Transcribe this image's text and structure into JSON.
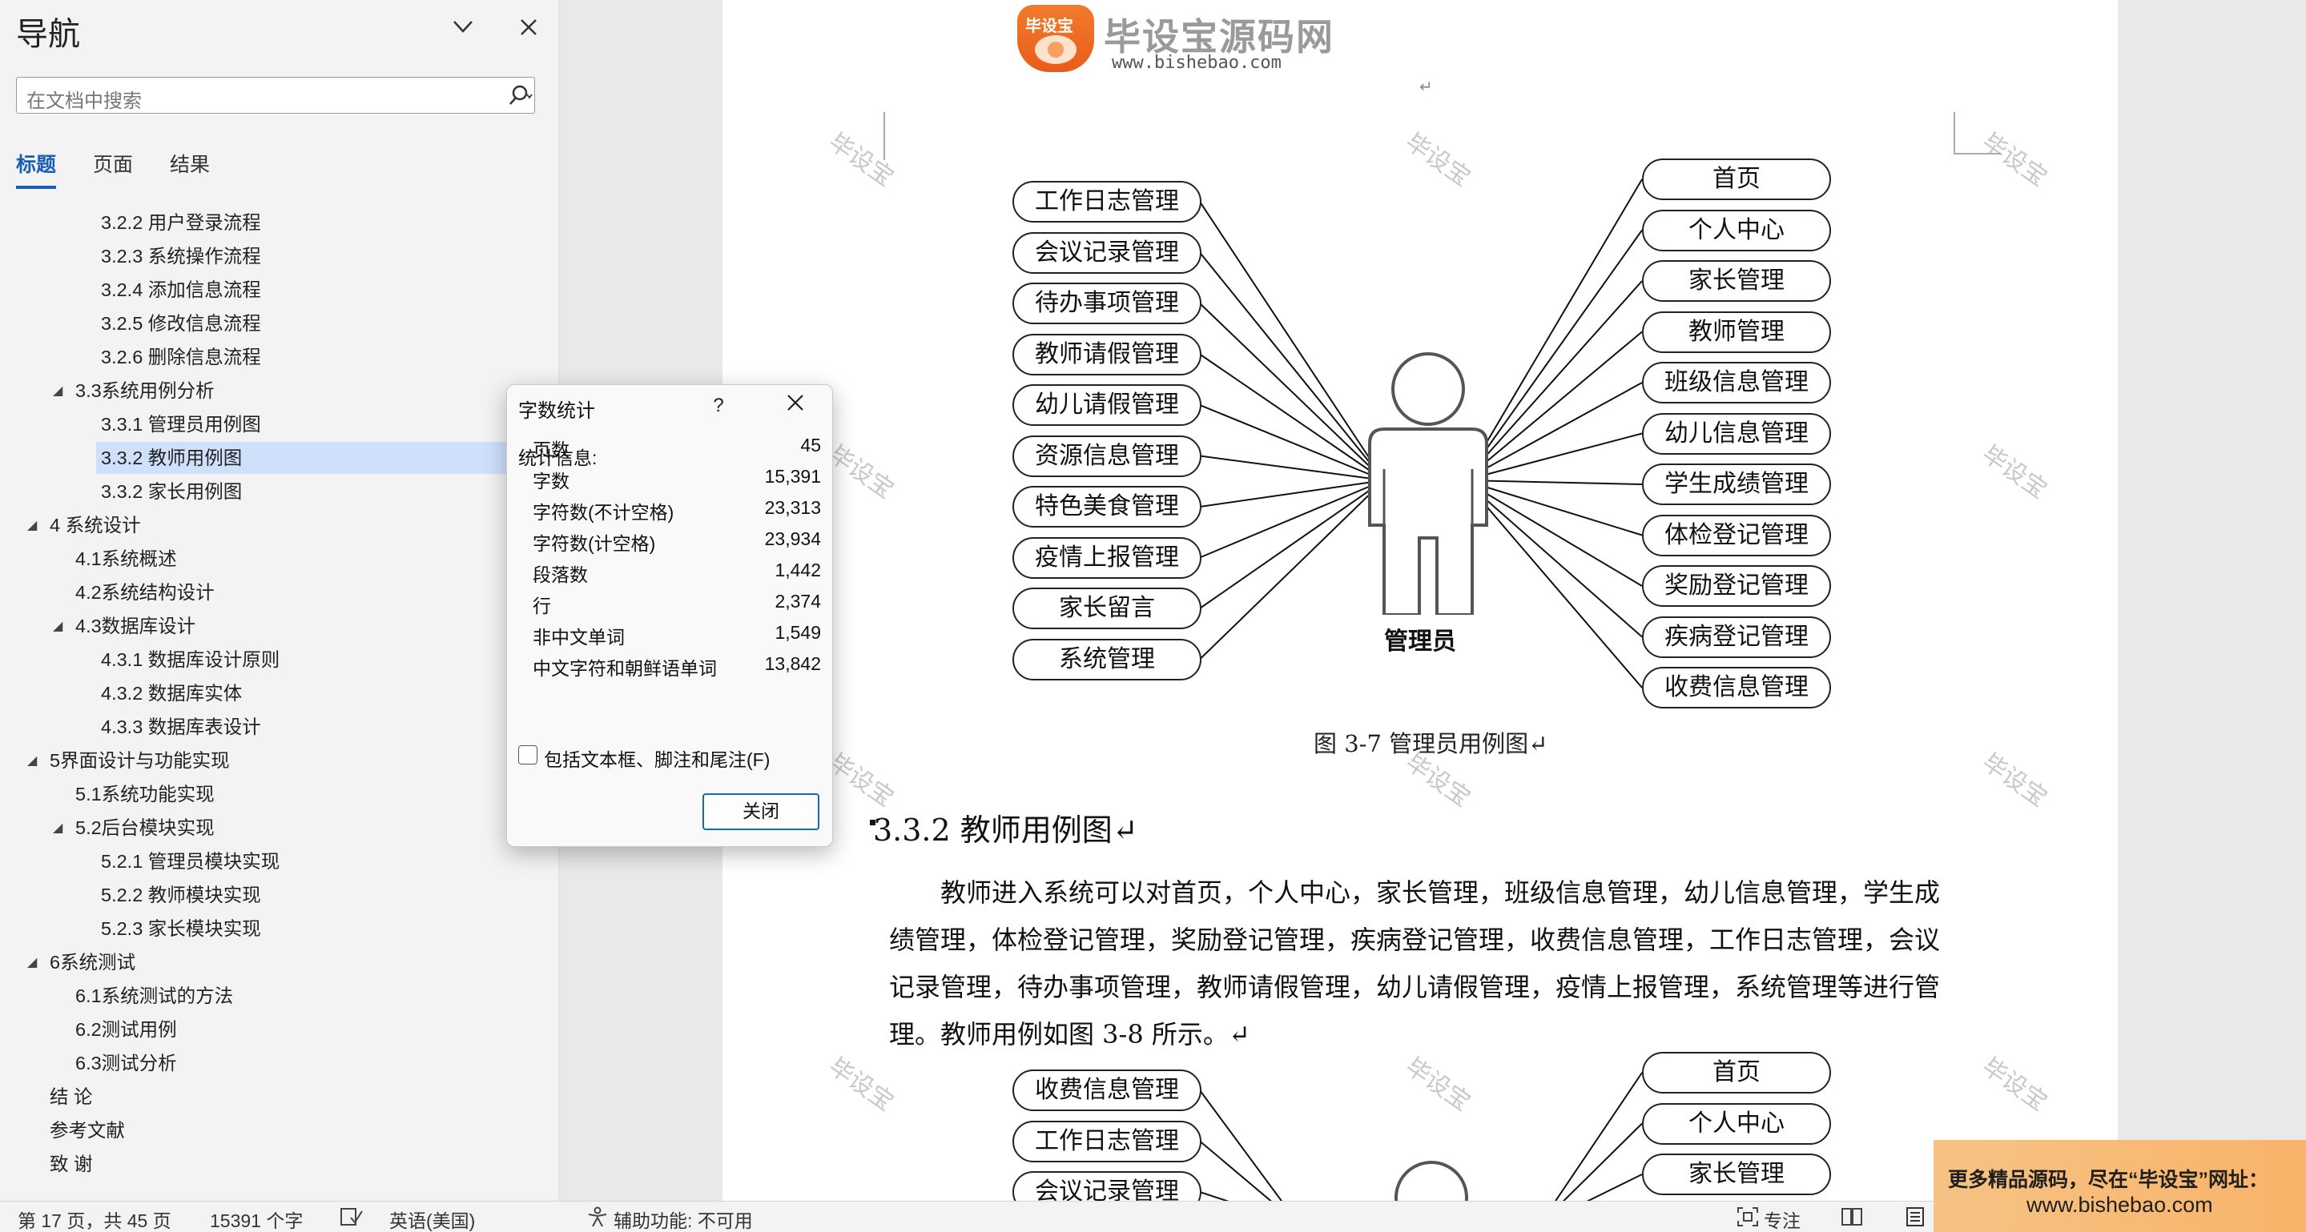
{
  "nav": {
    "title": "导航",
    "search_placeholder": "在文档中搜索",
    "tabs": [
      "标题",
      "页面",
      "结果"
    ],
    "outline": [
      {
        "text": "3.2.2 用户登录流程",
        "level": 3
      },
      {
        "text": "3.2.3 系统操作流程",
        "level": 3
      },
      {
        "text": "3.2.4 添加信息流程",
        "level": 3
      },
      {
        "text": "3.2.5 修改信息流程",
        "level": 3
      },
      {
        "text": "3.2.6 删除信息流程",
        "level": 3
      },
      {
        "text": "3.3系统用例分析",
        "level": 2,
        "expanded": true
      },
      {
        "text": "3.3.1 管理员用例图",
        "level": 3
      },
      {
        "text": "3.3.2 教师用例图",
        "level": 3,
        "selected": true
      },
      {
        "text": "3.3.2 家长用例图",
        "level": 3
      },
      {
        "text": "4 系统设计",
        "level": 1,
        "expanded": true
      },
      {
        "text": "4.1系统概述",
        "level": 2
      },
      {
        "text": "4.2系统结构设计",
        "level": 2
      },
      {
        "text": "4.3数据库设计",
        "level": 2,
        "expanded": true
      },
      {
        "text": "4.3.1 数据库设计原则",
        "level": 3
      },
      {
        "text": "4.3.2 数据库实体",
        "level": 3
      },
      {
        "text": "4.3.3 数据库表设计",
        "level": 3
      },
      {
        "text": "5界面设计与功能实现",
        "level": 1,
        "expanded": true
      },
      {
        "text": "5.1系统功能实现",
        "level": 2
      },
      {
        "text": "5.2后台模块实现",
        "level": 2,
        "expanded": true
      },
      {
        "text": "5.2.1 管理员模块实现",
        "level": 3
      },
      {
        "text": "5.2.2 教师模块实现",
        "level": 3
      },
      {
        "text": "5.2.3 家长模块实现",
        "level": 3
      },
      {
        "text": "6系统测试",
        "level": 1,
        "expanded": true
      },
      {
        "text": "6.1系统测试的方法",
        "level": 2
      },
      {
        "text": "6.2测试用例",
        "level": 2
      },
      {
        "text": "6.3测试分析",
        "level": 2
      },
      {
        "text": "结  论",
        "level": 1
      },
      {
        "text": "参考文献",
        "level": 1
      },
      {
        "text": "致  谢",
        "level": 1
      }
    ]
  },
  "logo": {
    "badge": "毕设宝",
    "title": "毕设宝源码网",
    "url": "www.bishebao.com"
  },
  "watermark": "毕设宝",
  "figure1": {
    "left_cases": [
      "工作日志管理",
      "会议记录管理",
      "待办事项管理",
      "教师请假管理",
      "幼儿请假管理",
      "资源信息管理",
      "特色美食管理",
      "疫情上报管理",
      "家长留言",
      "系统管理"
    ],
    "right_cases": [
      "首页",
      "个人中心",
      "家长管理",
      "教师管理",
      "班级信息管理",
      "幼儿信息管理",
      "学生成绩管理",
      "体检登记管理",
      "奖励登记管理",
      "疾病登记管理",
      "收费信息管理"
    ],
    "actor": "管理员",
    "caption": "图 3-7 管理员用例图↵"
  },
  "section": {
    "heading": "3.3.2  教师用例图↵",
    "paragraph": "教师进入系统可以对首页，个人中心，家长管理，班级信息管理，幼儿信息管理，学生成绩管理，体检登记管理，奖励登记管理，疾病登记管理，收费信息管理，工作日志管理，会议记录管理，待办事项管理，教师请假管理，幼儿请假管理，疫情上报管理，系统管理等进行管理。教师用例如图 3-8 所示。↵"
  },
  "figure2": {
    "left_cases": [
      "收费信息管理",
      "工作日志管理",
      "会议记录管理"
    ],
    "right_cases": [
      "首页",
      "个人中心",
      "家长管理"
    ]
  },
  "dialog": {
    "title": "字数统计",
    "help": "?",
    "section_label": "统计信息:",
    "stats": [
      {
        "label": "页数",
        "value": "45"
      },
      {
        "label": "字数",
        "value": "15,391"
      },
      {
        "label": "字符数(不计空格)",
        "value": "23,313"
      },
      {
        "label": "字符数(计空格)",
        "value": "23,934"
      },
      {
        "label": "段落数",
        "value": "1,442"
      },
      {
        "label": "行",
        "value": "2,374"
      },
      {
        "label": "非中文单词",
        "value": "1,549"
      },
      {
        "label": "中文字符和朝鲜语单词",
        "value": "13,842"
      }
    ],
    "checkbox_label": "包括文本框、脚注和尾注(F)",
    "checkbox_checked": false,
    "close_button": "关闭"
  },
  "statusbar": {
    "page": "第 17 页，共 45 页",
    "words": "15391 个字",
    "language": "英语(美国)",
    "accessibility": "辅助功能: 不可用",
    "focus": "专注"
  },
  "ad": {
    "line1": "更多精品源码，尽在“毕设宝”网址：",
    "line2": "www.bishebao.com"
  },
  "colors": {
    "accent": "#1a5fb4",
    "selection": "#cfe0fa",
    "dialog_button_border": "#0f6cbd",
    "ad_background": "#f9b36a"
  }
}
